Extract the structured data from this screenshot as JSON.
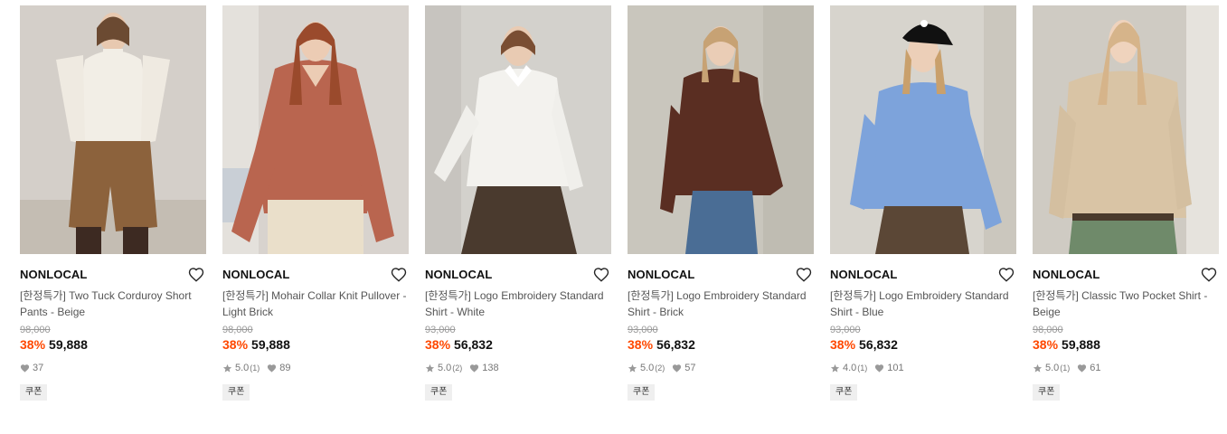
{
  "products": [
    {
      "brand": "NONLOCAL",
      "title": "[한정특가] Two Tuck Corduroy Short Pants - Beige",
      "original_price": "98,000",
      "discount": "38%",
      "price": "59,888",
      "rating": "",
      "rating_count": "",
      "likes": "37",
      "badge": "쿠폰"
    },
    {
      "brand": "NONLOCAL",
      "title": "[한정특가] Mohair Collar Knit Pullover - Light Brick",
      "original_price": "98,000",
      "discount": "38%",
      "price": "59,888",
      "rating": "5.0",
      "rating_count": "(1)",
      "likes": "89",
      "badge": "쿠폰"
    },
    {
      "brand": "NONLOCAL",
      "title": "[한정특가] Logo Embroidery Standard Shirt - White",
      "original_price": "93,000",
      "discount": "38%",
      "price": "56,832",
      "rating": "5.0",
      "rating_count": "(2)",
      "likes": "138",
      "badge": "쿠폰"
    },
    {
      "brand": "NONLOCAL",
      "title": "[한정특가] Logo Embroidery Standard Shirt - Brick",
      "original_price": "93,000",
      "discount": "38%",
      "price": "56,832",
      "rating": "5.0",
      "rating_count": "(2)",
      "likes": "57",
      "badge": "쿠폰"
    },
    {
      "brand": "NONLOCAL",
      "title": "[한정특가] Logo Embroidery Standard Shirt - Blue",
      "original_price": "93,000",
      "discount": "38%",
      "price": "56,832",
      "rating": "4.0",
      "rating_count": "(1)",
      "likes": "101",
      "badge": "쿠폰"
    },
    {
      "brand": "NONLOCAL",
      "title": "[한정특가] Classic Two Pocket Shirt - Beige",
      "original_price": "98,000",
      "discount": "38%",
      "price": "59,888",
      "rating": "5.0",
      "rating_count": "(1)",
      "likes": "61",
      "badge": "쿠폰"
    }
  ],
  "colors": {
    "discount": "#ff4800",
    "muted": "#999999",
    "badge_bg": "#efefef"
  },
  "icons": {
    "wishlist": "heart-outline-icon",
    "rating": "star-icon",
    "likes": "heart-filled-icon"
  }
}
